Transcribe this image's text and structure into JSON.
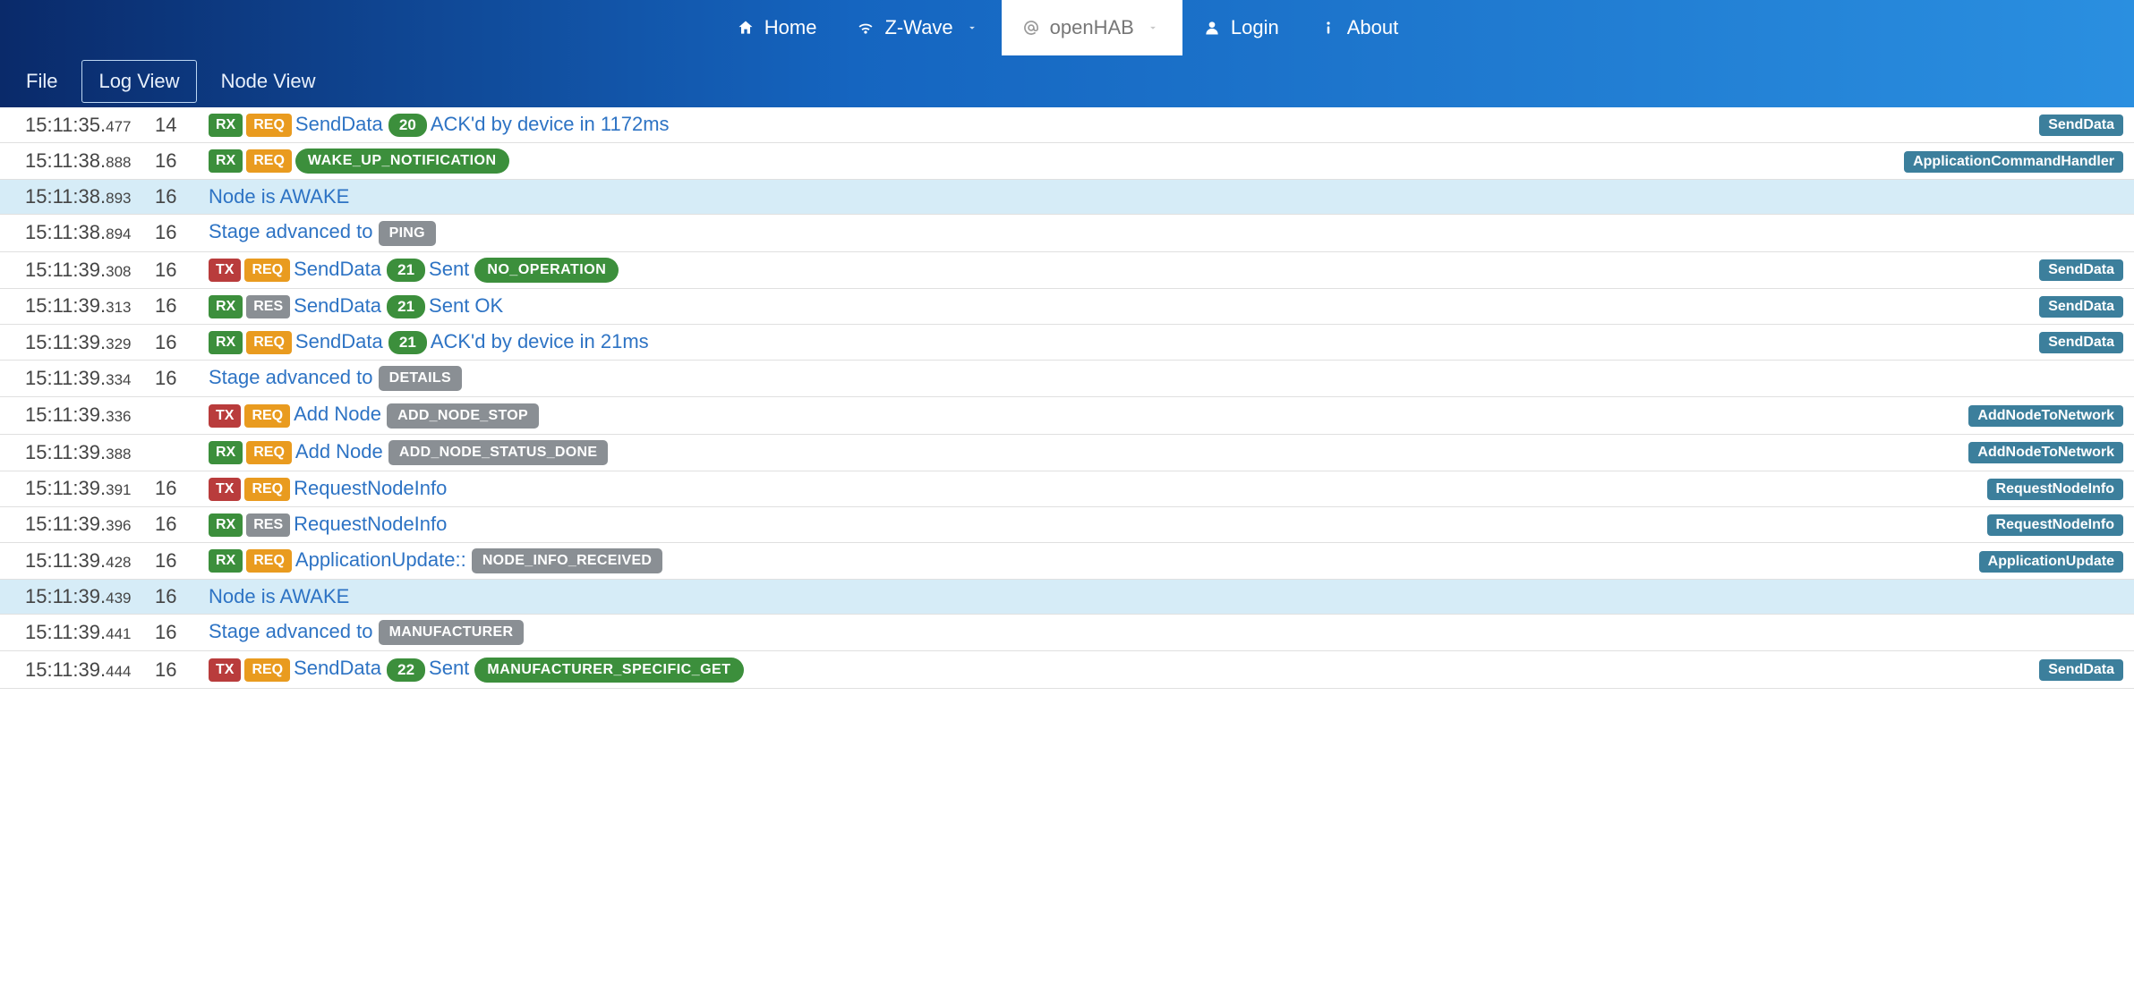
{
  "nav": {
    "home": "Home",
    "zwave": "Z-Wave",
    "openhab": "openHAB",
    "login": "Login",
    "about": "About"
  },
  "subnav": {
    "file": "File",
    "logview": "Log View",
    "nodeview": "Node View"
  },
  "log": [
    {
      "t": "15:11:35",
      "ms": "477",
      "node": "14",
      "hl": false,
      "right": "SendData",
      "parts": [
        {
          "k": "rx"
        },
        {
          "k": "req"
        },
        {
          "k": "link",
          "v": "SendData"
        },
        {
          "k": "counter",
          "v": "20"
        },
        {
          "k": "text",
          "v": "ACK'd by device in 1172ms"
        }
      ]
    },
    {
      "t": "15:11:38",
      "ms": "888",
      "node": "16",
      "hl": false,
      "right": "ApplicationCommandHandler",
      "parts": [
        {
          "k": "rx"
        },
        {
          "k": "req"
        },
        {
          "k": "pill-green",
          "v": "WAKE_UP_NOTIFICATION"
        }
      ]
    },
    {
      "t": "15:11:38",
      "ms": "893",
      "node": "16",
      "hl": true,
      "right": "",
      "parts": [
        {
          "k": "text",
          "v": "Node is AWAKE"
        }
      ]
    },
    {
      "t": "15:11:38",
      "ms": "894",
      "node": "16",
      "hl": false,
      "right": "",
      "parts": [
        {
          "k": "text",
          "v": "Stage advanced to "
        },
        {
          "k": "pill-grey",
          "v": "PING"
        }
      ]
    },
    {
      "t": "15:11:39",
      "ms": "308",
      "node": "16",
      "hl": false,
      "right": "SendData",
      "parts": [
        {
          "k": "tx"
        },
        {
          "k": "req"
        },
        {
          "k": "link",
          "v": "SendData"
        },
        {
          "k": "counter",
          "v": "21"
        },
        {
          "k": "text",
          "v": "Sent"
        },
        {
          "k": "pill-green",
          "v": "NO_OPERATION"
        }
      ]
    },
    {
      "t": "15:11:39",
      "ms": "313",
      "node": "16",
      "hl": false,
      "right": "SendData",
      "parts": [
        {
          "k": "rx"
        },
        {
          "k": "res"
        },
        {
          "k": "link",
          "v": "SendData"
        },
        {
          "k": "counter",
          "v": "21"
        },
        {
          "k": "text",
          "v": "Sent OK"
        }
      ]
    },
    {
      "t": "15:11:39",
      "ms": "329",
      "node": "16",
      "hl": false,
      "right": "SendData",
      "parts": [
        {
          "k": "rx"
        },
        {
          "k": "req"
        },
        {
          "k": "link",
          "v": "SendData"
        },
        {
          "k": "counter",
          "v": "21"
        },
        {
          "k": "text",
          "v": "ACK'd by device in 21ms"
        }
      ]
    },
    {
      "t": "15:11:39",
      "ms": "334",
      "node": "16",
      "hl": false,
      "right": "",
      "parts": [
        {
          "k": "text",
          "v": "Stage advanced to "
        },
        {
          "k": "pill-grey",
          "v": "DETAILS"
        }
      ]
    },
    {
      "t": "15:11:39",
      "ms": "336",
      "node": "",
      "hl": false,
      "right": "AddNodeToNetwork",
      "parts": [
        {
          "k": "tx"
        },
        {
          "k": "req"
        },
        {
          "k": "link",
          "v": "Add Node"
        },
        {
          "k": "pill-grey",
          "v": "ADD_NODE_STOP"
        }
      ]
    },
    {
      "t": "15:11:39",
      "ms": "388",
      "node": "",
      "hl": false,
      "right": "AddNodeToNetwork",
      "parts": [
        {
          "k": "rx"
        },
        {
          "k": "req"
        },
        {
          "k": "link",
          "v": "Add Node"
        },
        {
          "k": "pill-grey",
          "v": "ADD_NODE_STATUS_DONE"
        }
      ]
    },
    {
      "t": "15:11:39",
      "ms": "391",
      "node": "16",
      "hl": false,
      "right": "RequestNodeInfo",
      "parts": [
        {
          "k": "tx"
        },
        {
          "k": "req"
        },
        {
          "k": "link",
          "v": "RequestNodeInfo"
        }
      ]
    },
    {
      "t": "15:11:39",
      "ms": "396",
      "node": "16",
      "hl": false,
      "right": "RequestNodeInfo",
      "parts": [
        {
          "k": "rx"
        },
        {
          "k": "res"
        },
        {
          "k": "link",
          "v": "RequestNodeInfo"
        }
      ]
    },
    {
      "t": "15:11:39",
      "ms": "428",
      "node": "16",
      "hl": false,
      "right": "ApplicationUpdate",
      "parts": [
        {
          "k": "rx"
        },
        {
          "k": "req"
        },
        {
          "k": "link",
          "v": "ApplicationUpdate::"
        },
        {
          "k": "pill-grey",
          "v": "NODE_INFO_RECEIVED"
        }
      ]
    },
    {
      "t": "15:11:39",
      "ms": "439",
      "node": "16",
      "hl": true,
      "right": "",
      "parts": [
        {
          "k": "text",
          "v": "Node is AWAKE"
        }
      ]
    },
    {
      "t": "15:11:39",
      "ms": "441",
      "node": "16",
      "hl": false,
      "right": "",
      "parts": [
        {
          "k": "text",
          "v": "Stage advanced to "
        },
        {
          "k": "pill-grey",
          "v": "MANUFACTURER"
        }
      ]
    },
    {
      "t": "15:11:39",
      "ms": "444",
      "node": "16",
      "hl": false,
      "right": "SendData",
      "parts": [
        {
          "k": "tx"
        },
        {
          "k": "req"
        },
        {
          "k": "link",
          "v": "SendData"
        },
        {
          "k": "counter",
          "v": "22"
        },
        {
          "k": "text",
          "v": "Sent"
        },
        {
          "k": "pill-green",
          "v": "MANUFACTURER_SPECIFIC_GET"
        }
      ]
    }
  ],
  "badgeLabels": {
    "rx": "RX",
    "tx": "TX",
    "req": "REQ",
    "res": "RES"
  }
}
